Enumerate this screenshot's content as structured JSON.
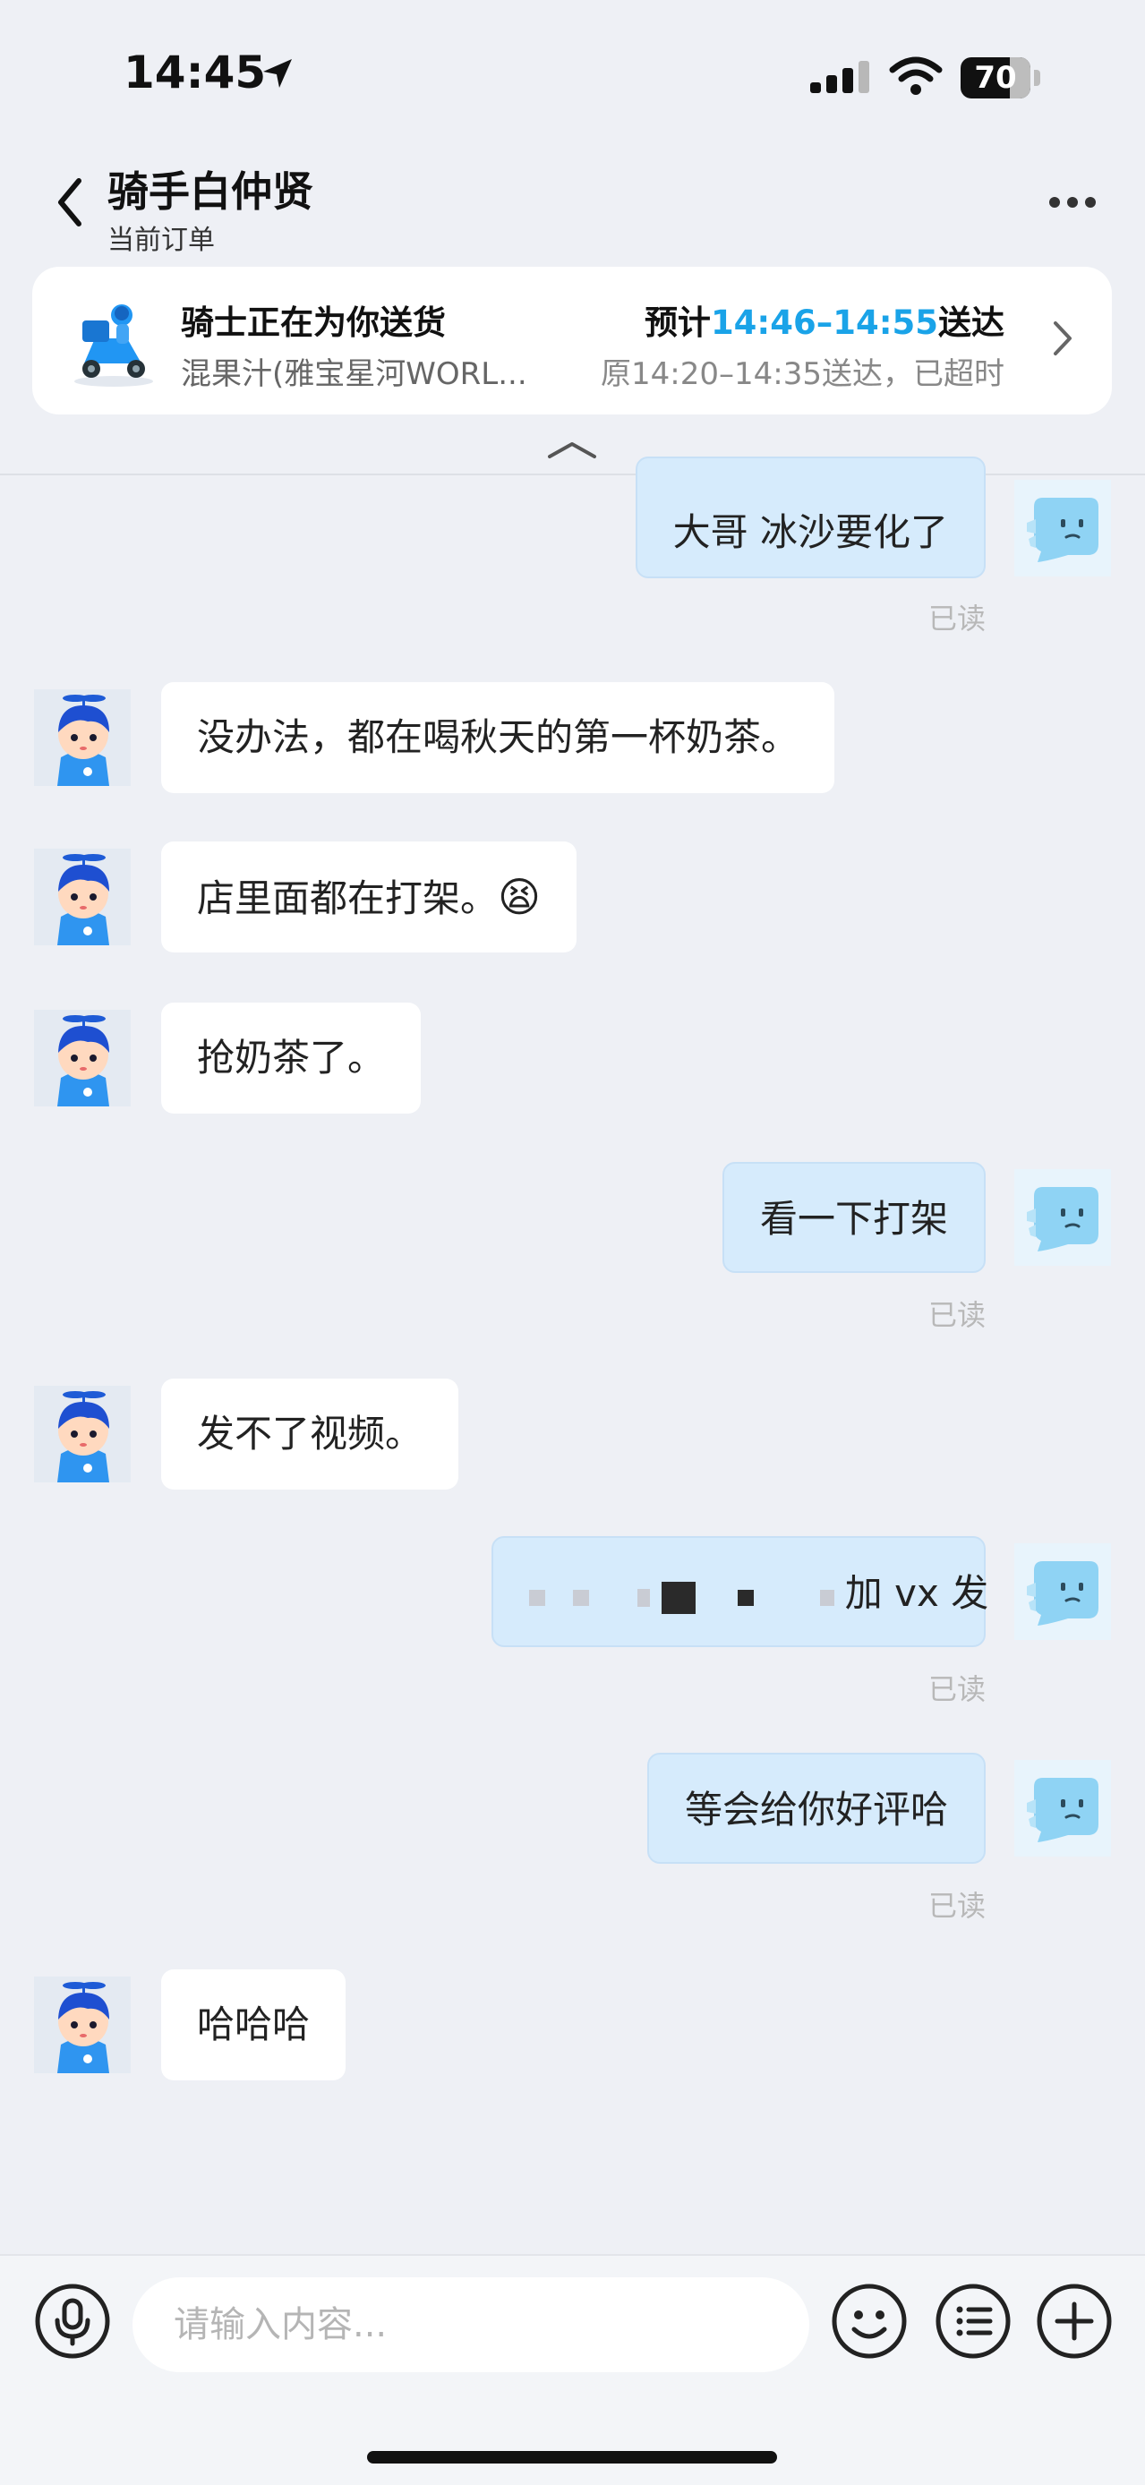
{
  "status_bar": {
    "time": "14:45",
    "battery": "70",
    "battery_level": 0.7
  },
  "header": {
    "title": "骑手白仲贤",
    "subtitle": "当前订单"
  },
  "order_card": {
    "status": "骑士正在为你送货",
    "shop": "混果汁(雅宝星河WORL...",
    "eta_prefix": "预计",
    "eta_time": "14:46–14:55",
    "eta_suffix": "送达",
    "original_time": "原14:20–14:35送达，已超时"
  },
  "messages": [
    {
      "from": "me",
      "text": "大哥 冰沙要化了",
      "read": "已读"
    },
    {
      "from": "rider",
      "text": "没办法，都在喝秋天的第一杯奶茶。"
    },
    {
      "from": "rider",
      "text": "店里面都在打架。",
      "emoji": "😫"
    },
    {
      "from": "rider",
      "text": "抢奶茶了。"
    },
    {
      "from": "me",
      "text": "看一下打架",
      "read": "已读"
    },
    {
      "from": "rider",
      "text": "发不了视频。"
    },
    {
      "from": "me",
      "text": "加 vx 发",
      "redacted": true,
      "read": "已读"
    },
    {
      "from": "me",
      "text": "等会给你好评哈",
      "read": "已读"
    },
    {
      "from": "rider",
      "text": "哈哈哈"
    }
  ],
  "input": {
    "placeholder": "请输入内容..."
  },
  "icons": {
    "back": "back-arrow-icon",
    "more": "more-dots-icon",
    "mic": "microphone-icon",
    "emoji": "smile-icon",
    "list": "quick-phrases-icon",
    "plus": "plus-icon"
  },
  "colors": {
    "accent": "#1aa3e8",
    "bubble_out": "#d6ebfc",
    "background": "#eef0f5"
  }
}
